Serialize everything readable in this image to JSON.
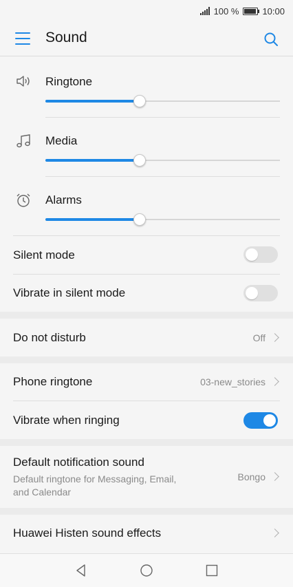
{
  "status_bar": {
    "battery_text": "100 %",
    "time": "10:00"
  },
  "header": {
    "title": "Sound",
    "menu_icon": "hamburger-menu-icon",
    "search_icon": "search-icon"
  },
  "volumes": [
    {
      "label": "Ringtone",
      "icon": "speaker-icon",
      "level_percent": 40
    },
    {
      "label": "Media",
      "icon": "music-note-icon",
      "level_percent": 40
    },
    {
      "label": "Alarms",
      "icon": "alarm-clock-icon",
      "level_percent": 40
    }
  ],
  "toggles": {
    "silent_mode": {
      "label": "Silent mode",
      "on": false
    },
    "vibrate_in_silent_mode": {
      "label": "Vibrate in silent mode",
      "on": false
    }
  },
  "do_not_disturb": {
    "label": "Do not disturb",
    "value": "Off"
  },
  "phone_ringtone": {
    "label": "Phone ringtone",
    "value": "03-new_stories"
  },
  "vibrate_when_ringing": {
    "label": "Vibrate when ringing",
    "on": true
  },
  "default_notification": {
    "label": "Default notification sound",
    "subtitle": "Default ringtone for Messaging, Email, and Calendar",
    "value": "Bongo"
  },
  "histen": {
    "label": "Huawei Histen sound effects"
  },
  "nav_bar": {
    "back_icon": "back-triangle-icon",
    "home_icon": "home-circle-icon",
    "recents_icon": "recents-square-icon"
  },
  "colors": {
    "accent": "#1e88e5",
    "background": "#f5f5f5",
    "section_gap": "#ebebeb"
  }
}
